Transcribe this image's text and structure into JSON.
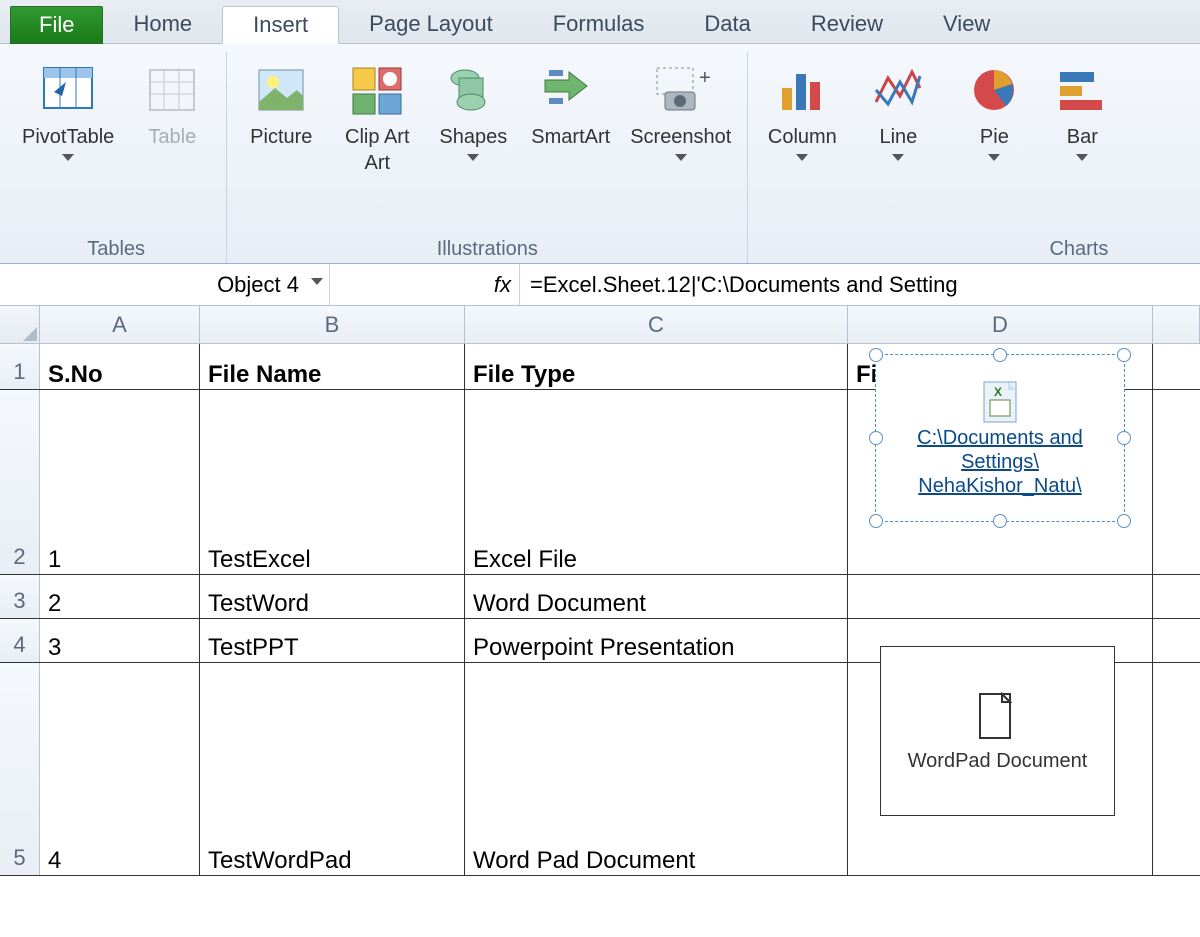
{
  "tabs": {
    "file": "File",
    "list": [
      "Home",
      "Insert",
      "Page Layout",
      "Formulas",
      "Data",
      "Review",
      "View"
    ],
    "active": "Insert"
  },
  "ribbon": {
    "groups": [
      {
        "label": "Tables",
        "buttons": [
          {
            "label": "PivotTable",
            "drop": true
          },
          {
            "label": "Table",
            "disabled": true
          }
        ]
      },
      {
        "label": "Illustrations",
        "buttons": [
          {
            "label": "Picture"
          },
          {
            "label": "Clip Art"
          },
          {
            "label": "Shapes",
            "drop": true
          },
          {
            "label": "SmartArt"
          },
          {
            "label": "Screenshot",
            "drop": true
          }
        ]
      },
      {
        "label": "Charts",
        "buttons": [
          {
            "label": "Column",
            "drop": true
          },
          {
            "label": "Line",
            "drop": true
          },
          {
            "label": "Pie",
            "drop": true
          },
          {
            "label": "Bar",
            "drop": true
          }
        ]
      }
    ]
  },
  "formula": {
    "name_box": "Object 4",
    "fx_label": "fx",
    "value": "=Excel.Sheet.12|'C:\\Documents and Setting"
  },
  "columns": [
    "A",
    "B",
    "C",
    "D"
  ],
  "table": {
    "headers": [
      "S.No",
      "File Name",
      "File Type",
      "File added as object"
    ],
    "rows": [
      {
        "sno": "1",
        "name": "TestExcel",
        "type": "Excel File"
      },
      {
        "sno": "2",
        "name": "TestWord",
        "type": "Word Document"
      },
      {
        "sno": "3",
        "name": "TestPPT",
        "type": "Powerpoint Presentation"
      },
      {
        "sno": "4",
        "name": "TestWordPad",
        "type": "Word Pad Document"
      }
    ]
  },
  "objects": {
    "selected": {
      "caption_line1": "C:\\Documents and",
      "caption_line2": "Settings\\",
      "caption_line3": "NehaKishor_Natu\\"
    },
    "wordpad": {
      "caption": "WordPad Document"
    }
  }
}
